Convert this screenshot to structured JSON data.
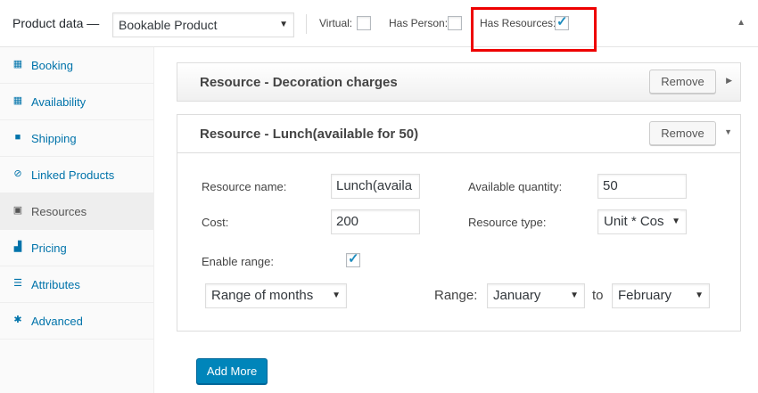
{
  "header": {
    "title": "Product data —",
    "product_type": "Bookable Product",
    "virtual_label": "Virtual:",
    "virtual_checked": false,
    "has_person_label": "Has Person:",
    "has_person_checked": false,
    "has_resources_label": "Has Resources:",
    "has_resources_checked": true
  },
  "sidebar": {
    "items": [
      {
        "label": "Booking",
        "icon": "calendar-icon",
        "active": false
      },
      {
        "label": "Availability",
        "icon": "calendar-icon",
        "active": false
      },
      {
        "label": "Shipping",
        "icon": "truck-icon",
        "active": false
      },
      {
        "label": "Linked Products",
        "icon": "link-icon",
        "active": false
      },
      {
        "label": "Resources",
        "icon": "briefcase-icon",
        "active": true
      },
      {
        "label": "Pricing",
        "icon": "chart-icon",
        "active": false
      },
      {
        "label": "Attributes",
        "icon": "list-icon",
        "active": false
      },
      {
        "label": "Advanced",
        "icon": "gear-icon",
        "active": false
      }
    ]
  },
  "resources": [
    {
      "title": "Resource - Decoration charges",
      "remove_label": "Remove",
      "expanded": false
    },
    {
      "title": "Resource - Lunch(available for 50)",
      "remove_label": "Remove",
      "expanded": true
    }
  ],
  "form": {
    "resource_name_label": "Resource name:",
    "resource_name_value": "Lunch(availa",
    "available_quantity_label": "Available quantity:",
    "available_quantity_value": "50",
    "cost_label": "Cost:",
    "cost_value": "200",
    "resource_type_label": "Resource type:",
    "resource_type_value": "Unit * Cos",
    "enable_range_label": "Enable range:",
    "enable_range_checked": true,
    "range_type_value": "Range of months",
    "range_label": "Range:",
    "range_from": "January",
    "to_label": "to",
    "range_to": "February"
  },
  "add_more_label": "Add More",
  "colors": {
    "accent": "#0073aa",
    "button_primary": "#0085ba",
    "highlight": "#e00000"
  }
}
